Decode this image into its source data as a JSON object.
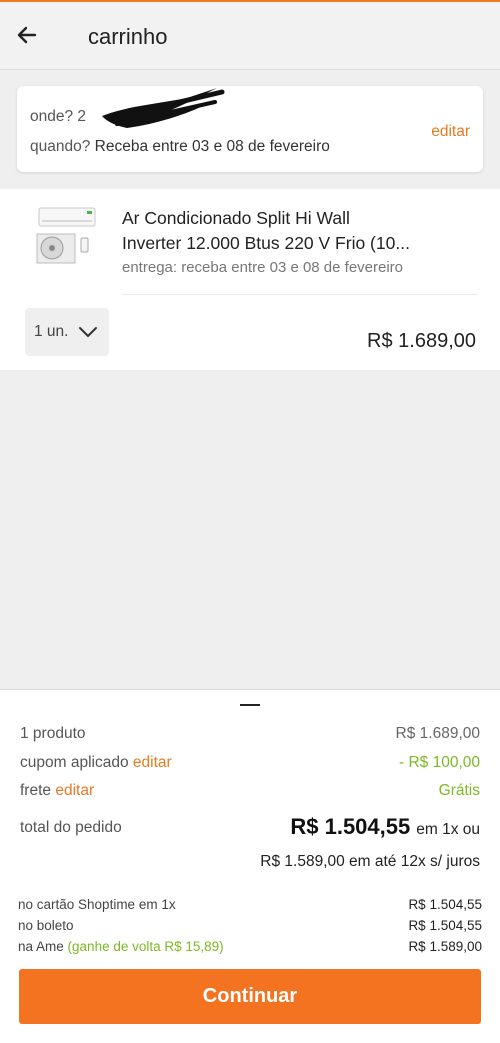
{
  "header": {
    "title": "carrinho",
    "back_icon": "arrow-left-icon"
  },
  "delivery": {
    "where_label": "onde?",
    "where_value": "2",
    "when_label": "quando?",
    "when_value": "Receba entre 03 e 08 de fevereiro",
    "edit_label": "editar"
  },
  "product": {
    "name_line1": "Ar Condicionado Split Hi Wall",
    "name_line2": "Inverter 12.000 Btus 220 V Frio (10...",
    "delivery": "entrega: receba entre 03 e 08 de fevereiro",
    "quantity": "1 un.",
    "price": "R$ 1.689,00"
  },
  "summary": {
    "products_label": "1 produto",
    "products_value": "R$ 1.689,00",
    "coupon_label": "cupom aplicado",
    "coupon_edit": "editar",
    "coupon_value": "- R$ 100,00",
    "shipping_label": "frete",
    "shipping_edit": "editar",
    "shipping_value": "Grátis",
    "total_label": "total do pedido",
    "total_value": "R$ 1.504,55",
    "total_suffix": "em 1x ou",
    "installments": "R$ 1.589,00 em até 12x s/ juros",
    "payment_options": [
      {
        "label": "no cartão Shoptime em 1x",
        "extra": "",
        "value": "R$ 1.504,55"
      },
      {
        "label": "no boleto",
        "extra": "",
        "value": "R$ 1.504,55"
      },
      {
        "label": "na Ame",
        "extra": "(ganhe de volta R$ 15,89)",
        "value": "R$ 1.589,00"
      }
    ],
    "continue_label": "Continuar"
  },
  "colors": {
    "accent": "#f47321",
    "link": "#e37b22",
    "green": "#7cb923"
  }
}
